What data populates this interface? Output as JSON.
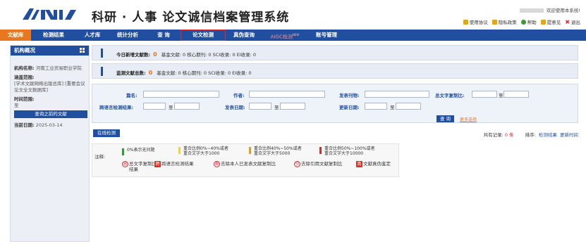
{
  "header": {
    "site_title": "科研 · 人事 论文诚信档案管理系统",
    "welcome": "欢迎使用本系统!",
    "links": [
      {
        "label": "使用协议",
        "icon": "agreement-icon",
        "color": "#e8a317"
      },
      {
        "label": "隐私政策",
        "icon": "privacy-icon",
        "color": "#e8a317"
      },
      {
        "label": "帮助",
        "icon": "help-icon",
        "color": "#3a9a3a"
      },
      {
        "label": "提意见",
        "icon": "feedback-icon",
        "color": "#e8a317"
      },
      {
        "label": "退出",
        "icon": "exit-icon",
        "color": "#e02b2b"
      }
    ]
  },
  "nav": {
    "items": [
      {
        "label": "文献库"
      },
      {
        "label": "检测结果"
      },
      {
        "label": "人才库"
      },
      {
        "label": "统计分析"
      },
      {
        "label": "查 询"
      },
      {
        "label": "论文检测"
      },
      {
        "label": "真伪查询"
      },
      {
        "label": "AIGC检测",
        "badge": "NEW"
      },
      {
        "label": "账号管理"
      }
    ]
  },
  "sidebar": {
    "title": "机构概况",
    "org_label": "机构名称:",
    "org_value": "河南工业贸易职业学院",
    "scope_label": "涵盖范围:",
    "scope_value": "[学术文献网络出版总库] [重要会议论文全文数据库]",
    "time_label": "时间范围:",
    "time_value": "至",
    "query_button": "查询之前的文献",
    "date_label": "当前日期:",
    "date_value": "2025-03-14"
  },
  "stats": {
    "today_label": "今日新增文献数:",
    "today_value": "0",
    "today_detail": "基金文献: 0   核心期刊: 0   SCI收录: 0   EI收录: 0",
    "total_label": "监测文献总数:",
    "total_value": "0",
    "total_detail": "基金文献: 0   核心期刊: 0   SCI收录: 0   EI收录: 0"
  },
  "search": {
    "title_label": "篇名:",
    "author_label": "作者:",
    "journal_label": "发表刊物:",
    "similarity_label": "总文字复制比:",
    "crosslang_label": "跨语言检测结果:",
    "pubdate_label": "发表日期:",
    "update_label": "更新日期:",
    "to": "至",
    "query_button": "查 询",
    "more_options": "更多选项"
  },
  "results": {
    "online_button": "在线检测",
    "records_label": "共有记录:",
    "records_count": "0 条",
    "sort_label": "排序:",
    "sort_options": [
      "检测结果",
      "更新时间"
    ]
  },
  "legend": {
    "note": "注释:",
    "items": [
      {
        "text": "0%表示无问题",
        "color": "#2e9e2e"
      },
      {
        "text": "重合比例0%~40%或者\n重合文字大于1000",
        "color": "#f2d23c"
      },
      {
        "text": "重合比例40%~50%或者\n重合文字大于5000",
        "color": "#e89a1c"
      },
      {
        "text": "重合比例50%~100%或者\n重合文字大于10000",
        "color": "#d42a2a"
      }
    ],
    "icons": [
      {
        "glyph": "总",
        "text": "总文字复制比\n结果"
      },
      {
        "glyph": "跨",
        "text": "跨语言检测结果"
      },
      {
        "glyph": "去",
        "text": "去除本人已发表文献复制比"
      },
      {
        "glyph": "引",
        "text": "去除引用文献复制比"
      },
      {
        "glyph": "真",
        "text": "文献真伪鉴定"
      }
    ]
  }
}
